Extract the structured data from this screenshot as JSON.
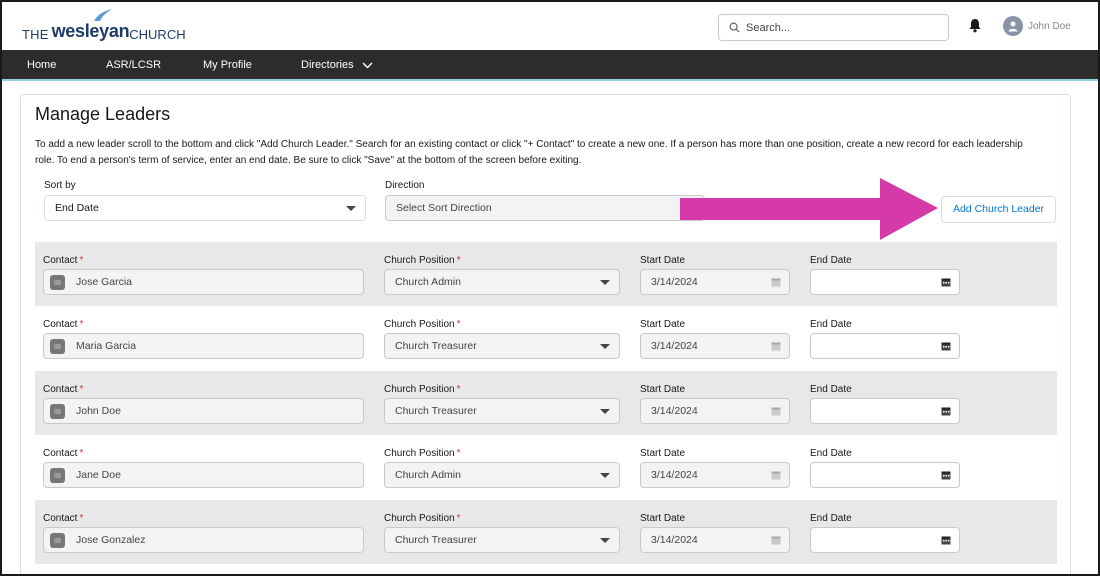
{
  "header": {
    "logo": {
      "the": "THE",
      "wesleyan": "wesleyan",
      "church": "CHURCH"
    },
    "search_placeholder": "Search...",
    "user_name": "John Doe"
  },
  "nav": {
    "items": [
      {
        "label": "Home"
      },
      {
        "label": "ASR/LCSR"
      },
      {
        "label": "My Profile"
      },
      {
        "label": "Directories"
      }
    ]
  },
  "page": {
    "title": "Manage Leaders",
    "intro_line1": "To add a new leader scroll to the bottom and click \"Add Church Leader.\" Search for an existing contact or click \"+ Contact\" to create a new one. If a person has more than one position, create a new record for each leadership",
    "intro_line2": "role. To end a person's term of service, enter an end date. Be sure to click \"Save\" at the bottom of the screen before exiting.",
    "sort_by_label": "Sort by",
    "sort_by_value": "End Date",
    "direction_label": "Direction",
    "direction_value": "Select Sort Direction",
    "add_button": "Add Church Leader",
    "arrow_color": "#d63aa9"
  },
  "columns": {
    "contact": "Contact",
    "position": "Church Position",
    "start": "Start Date",
    "end": "End Date",
    "required": "*"
  },
  "leaders": [
    {
      "contact": "Jose Garcia",
      "position": "Church Admin",
      "start_date": "3/14/2024",
      "end_date": ""
    },
    {
      "contact": "Maria Garcia",
      "position": "Church Treasurer",
      "start_date": "3/14/2024",
      "end_date": ""
    },
    {
      "contact": "John Doe",
      "position": "Church Treasurer",
      "start_date": "3/14/2024",
      "end_date": ""
    },
    {
      "contact": "Jane Doe",
      "position": "Church Admin",
      "start_date": "3/14/2024",
      "end_date": ""
    },
    {
      "contact": "Jose Gonzalez",
      "position": "Church Treasurer",
      "start_date": "3/14/2024",
      "end_date": ""
    }
  ]
}
